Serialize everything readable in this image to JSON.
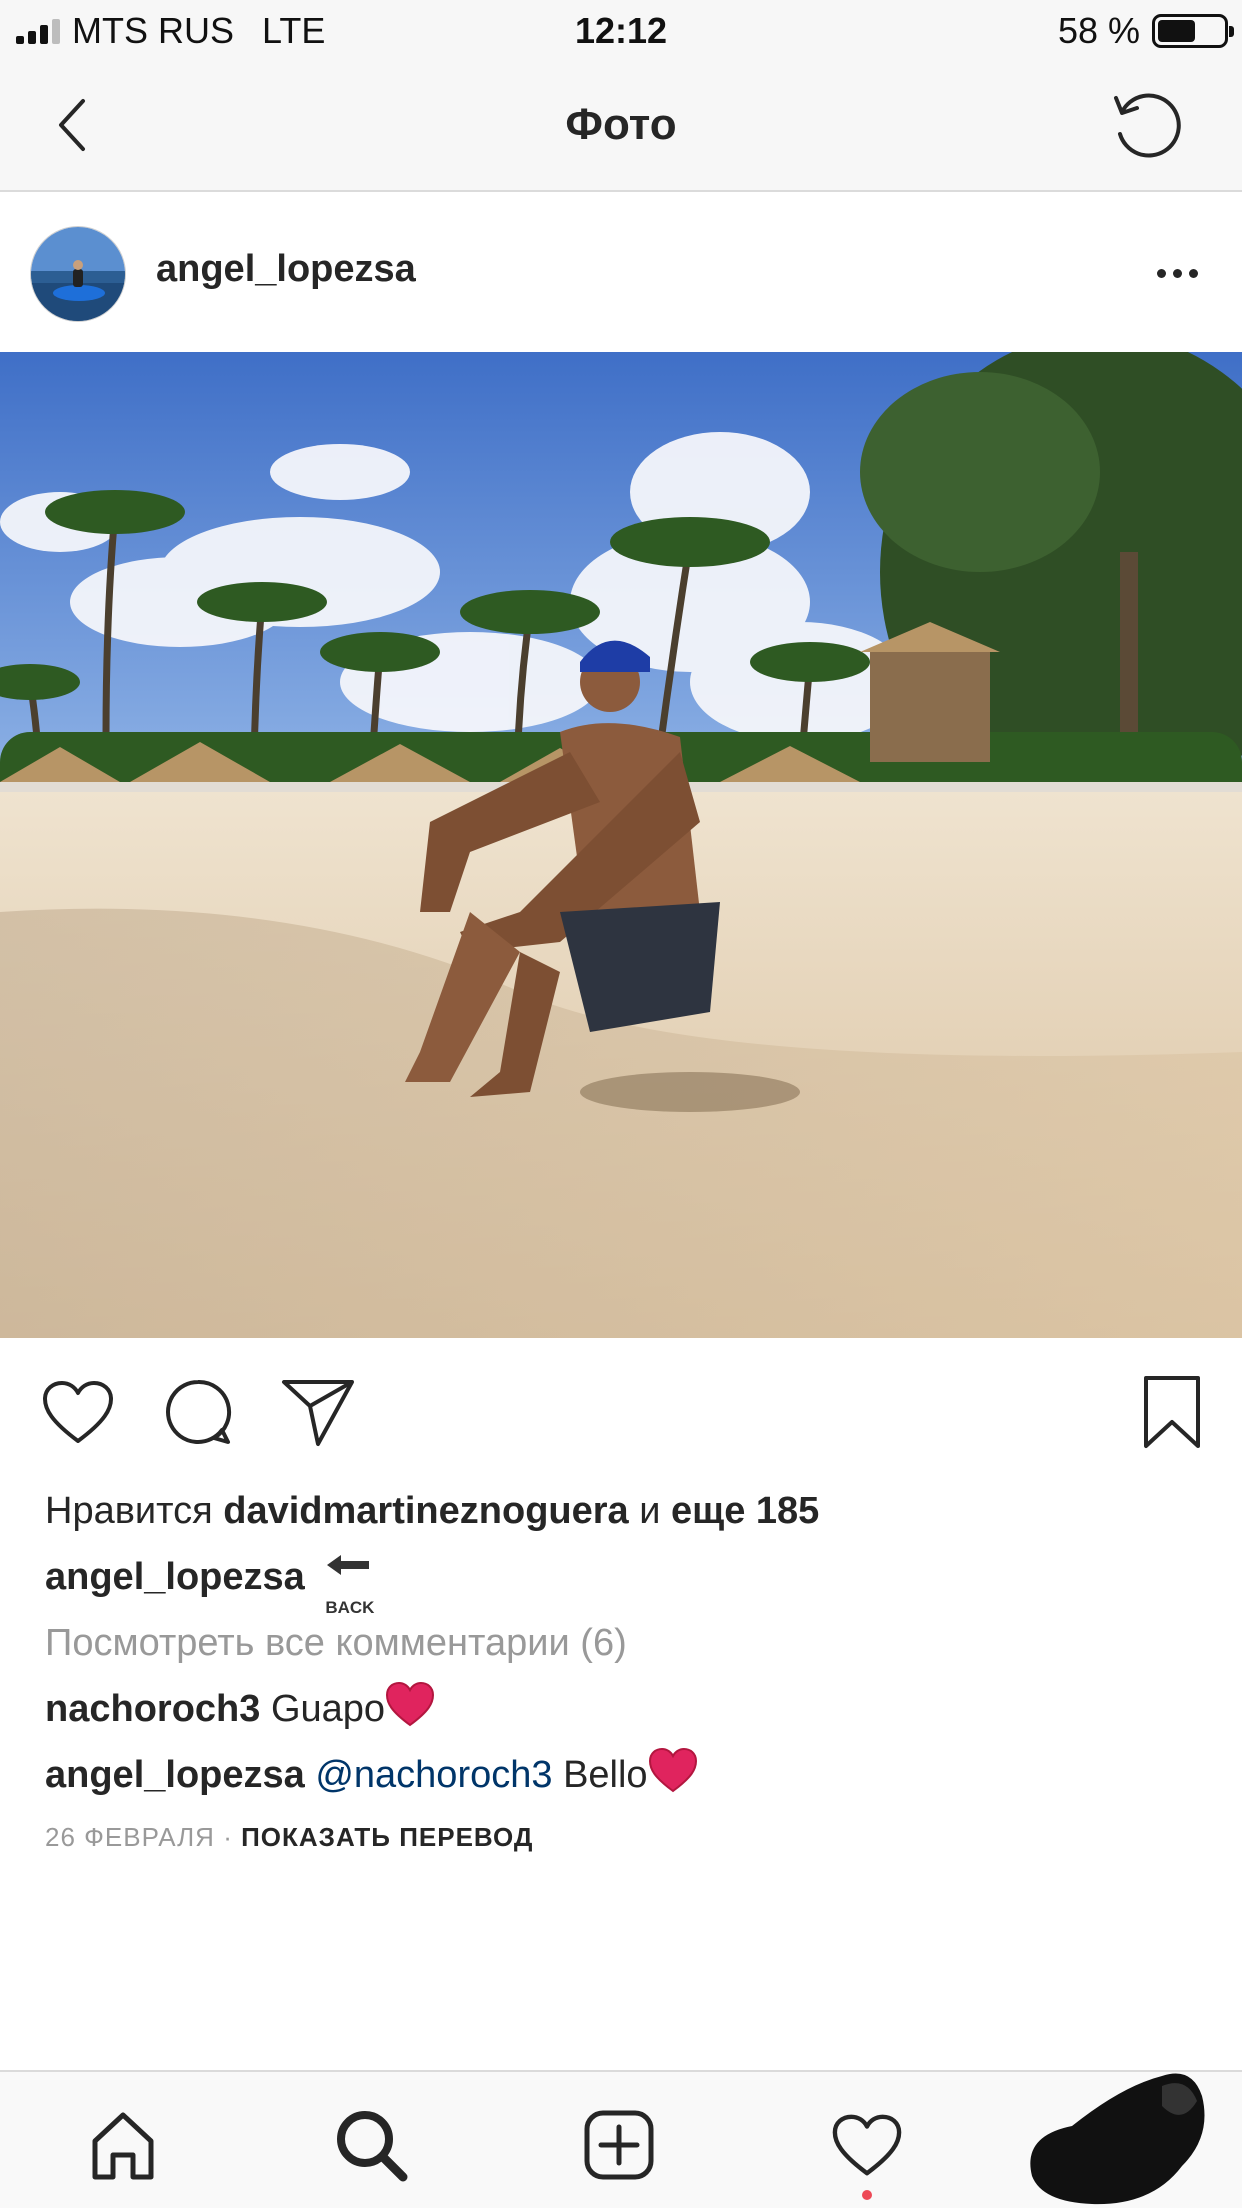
{
  "status_bar": {
    "carrier": "MTS RUS",
    "network": "LTE",
    "time": "12:12",
    "battery": "58 %",
    "battery_level": 0.58
  },
  "nav": {
    "title": "Фото",
    "back_icon": "chevron-left-icon",
    "refresh_icon": "refresh-icon"
  },
  "post": {
    "username": "angel_lopezsa",
    "more_icon": "ellipsis-icon",
    "photo_description_icon": "beach-photo"
  },
  "actions": {
    "like_icon": "heart-icon",
    "comment_icon": "comment-icon",
    "share_icon": "paper-plane-icon",
    "save_icon": "bookmark-icon"
  },
  "likes": {
    "prefix": "Нравится",
    "user": "davidmartineznoguera",
    "connector": "и",
    "more": "еще 185"
  },
  "caption": {
    "username": "angel_lopezsa",
    "emoji_label": "BACK"
  },
  "view_comments": "Посмотреть все комментарии (6)",
  "comments": [
    {
      "username": "nachoroch3",
      "text": "Guapo"
    },
    {
      "username": "angel_lopezsa",
      "mention": "@nachoroch3",
      "text": "Bello"
    }
  ],
  "date": "26 ФЕВРАЛЯ",
  "separator": "·",
  "translate": "ПОКАЗАТЬ ПЕРЕВОД",
  "tabbar": {
    "home_icon": "home-icon",
    "search_icon": "search-icon",
    "add_icon": "add-post-icon",
    "activity_icon": "heart-icon",
    "profile_icon": "profile-avatar"
  },
  "colors": {
    "text": "#262626",
    "muted": "#999999",
    "mention": "#003569",
    "heart": "#e0245e",
    "notification": "#ed4956"
  }
}
